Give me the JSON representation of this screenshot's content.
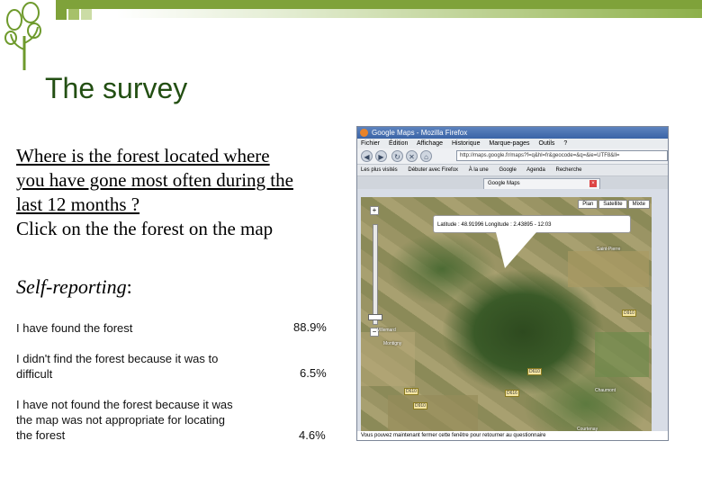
{
  "slide": {
    "title": "The survey",
    "question_underlined": [
      "Where is the forest located where",
      "you have gone most often during the",
      "last 12 months ?"
    ],
    "question_plain": "Click on the the forest on the map",
    "self_reporting_label": "Self-reporting",
    "self_reporting_colon": ":",
    "responses": [
      {
        "text_lines": [
          "I have found the forest"
        ],
        "percent": "88.9%"
      },
      {
        "text_lines": [
          "I didn't find the forest because it was to",
          "difficult"
        ],
        "percent": "6.5%"
      },
      {
        "text_lines": [
          "I have not found the forest because it was",
          "the map was not appropriate for locating",
          "the forest"
        ],
        "percent": "4.6%"
      }
    ]
  },
  "colors": {
    "title": "#234f13",
    "accent_green": "#7fa23a"
  },
  "browser": {
    "window_title": "Google Maps - Mozilla Firefox",
    "menu": [
      "Fichier",
      "Édition",
      "Affichage",
      "Historique",
      "Marque-pages",
      "Outils",
      "?"
    ],
    "url": "http://maps.google.fr/maps?f=q&hl=fr&geocode=&q=&ie=UTF8&ll=",
    "bookmarks": [
      "Les plus visités",
      "Débuter avec Firefox",
      "À la une",
      "Google",
      "Agenda",
      "Recherche"
    ],
    "tab_title": "Google Maps",
    "map_types": [
      "Plan",
      "Satellite",
      "Mixte"
    ],
    "tooltip": "Latitude : 48.91996 Longitude : 2.43895 - 12:03",
    "road_labels": [
      "D910",
      "D610",
      "D616",
      "D610",
      "D910"
    ],
    "place_labels": [
      "Villemard",
      "Montigny",
      "Chaumont",
      "Saint-Pierre",
      "Courtenay"
    ],
    "status": "Vous pouvez maintenant fermer cette fenêtre pour retourner au questionnaire"
  }
}
